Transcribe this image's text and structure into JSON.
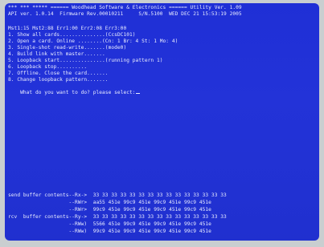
{
  "header": {
    "title_line": "*** *** ***** ====== Woodhead Software & Electronics ====== Utility Ver. 1.09",
    "info_line": "API ver. 1.0.14  Firmware Rev.00010211     S/N.5100  WED DEC 21 15:53:19 2005"
  },
  "status_line": "Mst1:15 Mst2:88 Err1:00 Err2:08 Err3:00",
  "menu": [
    {
      "label": "1. Show all cards...............(CcsDC101)"
    },
    {
      "label": "2. Open a card. Online ........(Cn: 1 Br: 4 St: 1 Mo: 4)"
    },
    {
      "label": "3. Single-shot read-write.......(mode0)"
    },
    {
      "label": "4. Build link with master......."
    },
    {
      "label": "5. Loopback start...............(running pattern 1)"
    },
    {
      "label": "6. Loopback stop.........."
    },
    {
      "label": "7. Offline. Close the card......."
    },
    {
      "label": "8. Change loopback pattern......."
    }
  ],
  "prompt": "What do you want to do? please select:",
  "buffers": [
    {
      "text": "send buffer contents--Rx->  33 33 33 33 33 33 33 33 33 33 33 33 33 33 33"
    },
    {
      "text": "                    --RWr>  aa55 451e 99c9 451e 99c9 451e 99c9 451e"
    },
    {
      "text": "                    --RWr>  99c9 451e 99c9 451e 99c9 451e 99c9 451e"
    },
    {
      "text": "rcv  buffer contents--Ry->  33 33 33 33 33 33 33 33 33 33 33 33 33 33 33"
    },
    {
      "text": "                    --RWw)  5566 451e 99c9 451e 99c9 451e 99c9 451e"
    },
    {
      "text": "                    --RWw)  99c9 451e 99c9 451e 99c9 451e 99c9 451e"
    }
  ]
}
